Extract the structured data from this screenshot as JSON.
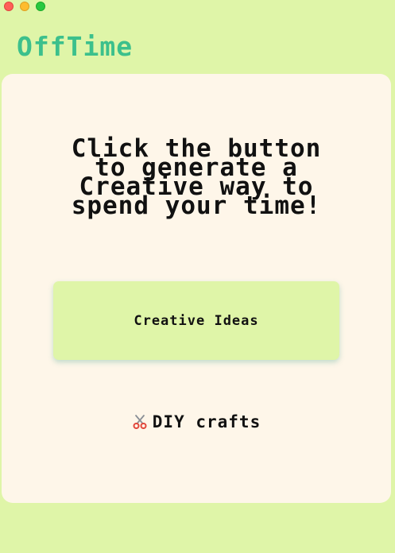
{
  "app": {
    "title": "OffTime"
  },
  "colors": {
    "background": "#dff5a8",
    "card": "#fef6e9",
    "accent": "#3cc08c",
    "text": "#111111"
  },
  "window_controls": [
    "close-icon",
    "minimize-icon",
    "maximize-icon"
  ],
  "prompt": {
    "lines": [
      "Click the button",
      "to generate a",
      "Creative way to",
      "spend your time!"
    ]
  },
  "button": {
    "label": "Creative Ideas"
  },
  "result": {
    "icon": "scissors-icon",
    "text": "DIY crafts"
  }
}
